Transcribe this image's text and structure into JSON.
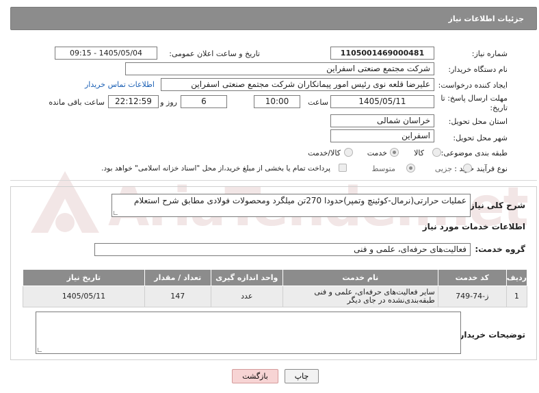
{
  "header": {
    "title": "جزئیات اطلاعات نیاز"
  },
  "fields": {
    "need_number_label": "شماره نیاز:",
    "need_number": "1105001469000481",
    "announce_datetime_label": "تاریخ و ساعت اعلان عمومی:",
    "announce_datetime": "1405/05/04 - 09:15",
    "buyer_org_label": "نام دستگاه خریدار:",
    "buyer_org": "شرکت مجتمع صنعتی اسفراین",
    "requester_label": "ایجاد کننده درخواست:",
    "requester": "علیرضا قلعه نوی رئیس امور پیمانکاران شرکت مجتمع صنعتی اسفراین",
    "buyer_contact_link": "اطلاعات تماس خریدار",
    "deadline_label_1": "مهلت ارسال پاسخ: تا",
    "deadline_label_2": "تاریخ:",
    "deadline_date": "1405/05/11",
    "time_label": "ساعت",
    "deadline_time": "10:00",
    "days_value": "6",
    "days_label": "روز و",
    "remaining_time": "22:12:59",
    "remaining_label": "ساعت باقی مانده",
    "province_label": "استان محل تحویل:",
    "province": "خراسان شمالی",
    "city_label": "شهر محل تحویل:",
    "city": "اسفراین",
    "category_label": "طبقه بندی موضوعی:",
    "category_options": [
      "کالا",
      "خدمت",
      "کالا/خدمت"
    ],
    "category_selected": "خدمت",
    "process_label": "نوع فرآیند خرید :",
    "process_options": [
      "جزیی",
      "متوسط"
    ],
    "process_selected": "متوسط",
    "treasury_note": "پرداخت تمام یا بخشی از مبلغ خرید،از محل \"اسناد خزانه اسلامی\" خواهد بود."
  },
  "description": {
    "label": "شرح کلی نیاز:",
    "text": "عملیات حرارتی(نرمال-کوئینچ وتمپر)حدودا 270تن میلگرد ومحصولات فولادی مطابق شرح استعلام"
  },
  "services": {
    "section_title": "اطلاعات خدمات مورد نیاز",
    "group_label": "گروه خدمت:",
    "group_value": "فعالیت‌های حرفه‌ای، علمی و فنی",
    "columns": [
      "ردیف",
      "کد خدمت",
      "نام خدمت",
      "واحد اندازه گیری",
      "تعداد / مقدار",
      "تاریخ نیاز"
    ],
    "rows": [
      [
        "1",
        "ز-74-749",
        "سایر فعالیت‌های حرفه‌ای، علمی و فنی طبقه‌بندی‌نشده در جای دیگر",
        "عدد",
        "147",
        "1405/05/11"
      ]
    ]
  },
  "notes": {
    "label": "توضیحات خریدار:"
  },
  "buttons": {
    "print": "چاپ",
    "back": "بازگشت"
  },
  "watermark": {
    "text": "AriaTender.net"
  }
}
